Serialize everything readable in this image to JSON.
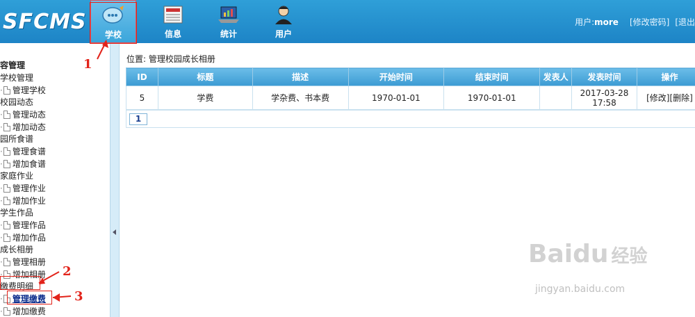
{
  "header": {
    "logo": "SFCMS",
    "nav": [
      {
        "label": "学校",
        "icon": "chat-bubble-icon"
      },
      {
        "label": "信息",
        "icon": "newspaper-icon"
      },
      {
        "label": "统计",
        "icon": "laptop-chart-icon"
      },
      {
        "label": "用户",
        "icon": "user-avatar-icon"
      }
    ],
    "user_prefix": "用户:",
    "username": "more",
    "change_password": "[修改密码]",
    "logout": "[退出"
  },
  "sidebar": {
    "title": "容管理",
    "groups": [
      {
        "label": "学校管理",
        "items": [
          "管理学校"
        ]
      },
      {
        "label": "校园动态",
        "items": [
          "管理动态",
          "增加动态"
        ]
      },
      {
        "label": "园所食谱",
        "items": [
          "管理食谱",
          "增加食谱"
        ]
      },
      {
        "label": "家庭作业",
        "items": [
          "管理作业",
          "增加作业"
        ]
      },
      {
        "label": "学生作品",
        "items": [
          "管理作品",
          "增加作品"
        ]
      },
      {
        "label": "成长相册",
        "items": [
          "管理相册",
          "增加相册"
        ]
      },
      {
        "label": "缴费明细",
        "items": [
          "管理缴费",
          "增加缴费"
        ]
      }
    ]
  },
  "main": {
    "breadcrumb": "位置: 管理校园成长相册",
    "columns": [
      "ID",
      "标题",
      "描述",
      "开始时间",
      "结束时间",
      "发表人",
      "发表时间",
      "操作"
    ],
    "rows": [
      {
        "id": "5",
        "title": "学费",
        "desc": "学杂费、书本费",
        "start": "1970-01-01",
        "end": "1970-01-01",
        "author": "",
        "pub_date": "2017-03-28",
        "pub_time": "17:58",
        "edit": "[修改]",
        "del": "[删除]"
      }
    ],
    "page": "1"
  },
  "annotations": {
    "m1": "1",
    "m2": "2",
    "m3": "3"
  },
  "watermark": {
    "brand": "Bai",
    "brand2": "du",
    "cn": "经验",
    "url": "jingyan.baidu.com"
  }
}
